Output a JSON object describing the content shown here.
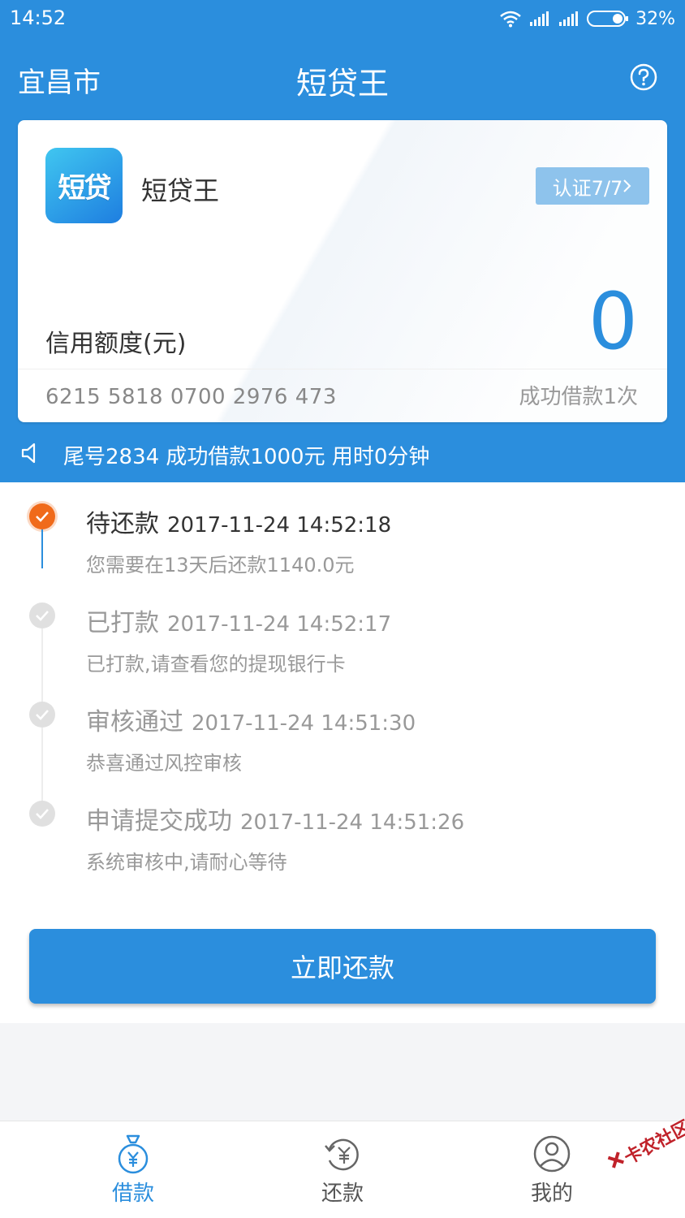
{
  "status_bar": {
    "time": "14:52",
    "battery": "32%"
  },
  "app_bar": {
    "city": "宜昌市",
    "title": "短贷王"
  },
  "card": {
    "logo_text": "短贷",
    "brand_name": "短贷王",
    "auth_label": "认证7/7",
    "credit_label": "信用额度(元)",
    "credit_value": "0",
    "card_number": "6215 5818 0700 2976 473",
    "success_count": "成功借款1次"
  },
  "notice": {
    "text": "尾号2834 成功借款1000元 用时0分钟"
  },
  "timeline": [
    {
      "status": "待还款",
      "datetime": "2017-11-24 14:52:18",
      "desc": "您需要在13天后还款1140.0元",
      "state": "active"
    },
    {
      "status": "已打款",
      "datetime": "2017-11-24 14:52:17",
      "desc": "已打款,请查看您的提现银行卡",
      "state": "done"
    },
    {
      "status": "审核通过",
      "datetime": "2017-11-24 14:51:30",
      "desc": "恭喜通过风控审核",
      "state": "done"
    },
    {
      "status": "申请提交成功",
      "datetime": "2017-11-24 14:51:26",
      "desc": "系统审核中,请耐心等待",
      "state": "done"
    }
  ],
  "repay_button": {
    "label": "立即还款"
  },
  "bottom_nav": [
    {
      "label": "借款",
      "icon": "money-bag-icon",
      "active": true
    },
    {
      "label": "还款",
      "icon": "refund-icon",
      "active": false
    },
    {
      "label": "我的",
      "icon": "user-icon",
      "active": false
    }
  ],
  "watermark": {
    "text": "卡农社区"
  },
  "colors": {
    "primary": "#2b8edd",
    "active_dot": "#f06a1a",
    "inactive_dot": "#e0e0e0"
  }
}
